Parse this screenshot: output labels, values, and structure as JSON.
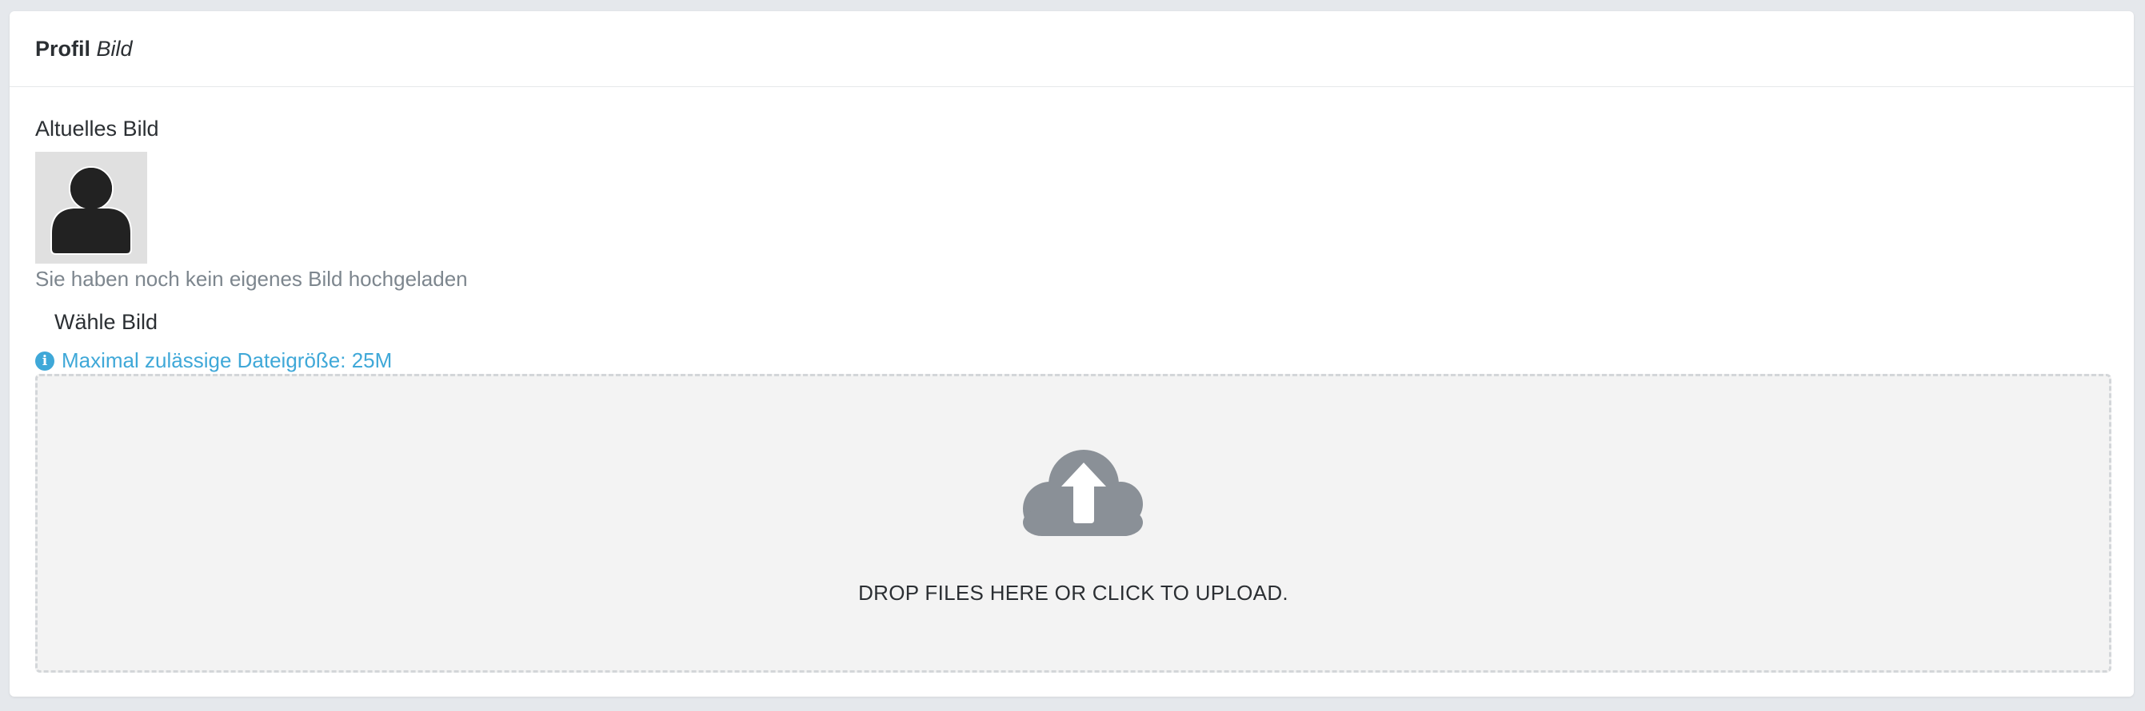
{
  "card": {
    "title_bold": "Profil",
    "title_italic": "Bild"
  },
  "current_image": {
    "label": "Altuelles Bild",
    "avatar_icon": "user-silhouette-icon",
    "hint": "Sie haben noch kein eigenes Bild hochgeladen"
  },
  "upload": {
    "label": "Wähle Bild",
    "max_size_icon": "info-icon",
    "max_size_text": "Maximal zulässige Dateigröße: 25M",
    "dropzone_icon": "cloud-upload-icon",
    "dropzone_text": "DROP FILES HERE OR CLICK TO UPLOAD."
  },
  "colors": {
    "info": "#3fa8d8",
    "muted": "#7d868e",
    "icon_gray": "#8a9097"
  }
}
